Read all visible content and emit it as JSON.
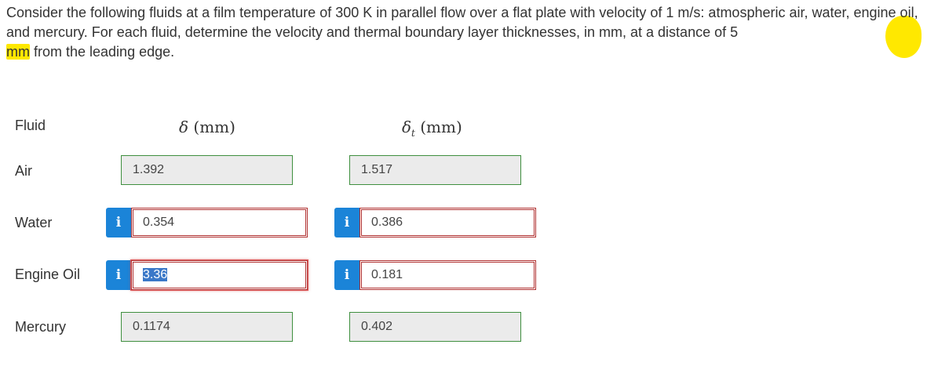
{
  "question": {
    "part1": "Consider the following fluids at a film temperature of 300 K in parallel flow over a flat plate with velocity of 1 m/s: atmospheric air, water, engine oil, and mercury. For each fluid, determine the velocity and thermal boundary layer thicknesses, in mm, at a distance ",
    "highlight1": "of 5",
    "highlight2": "mm",
    "part2": " from the leading edge."
  },
  "table": {
    "headers": {
      "fluid": "Fluid",
      "delta_symbol": "δ",
      "delta_unit": " (mm)",
      "delta_t_symbol": "δ",
      "delta_t_sub": "t",
      "delta_t_unit": " (mm)"
    },
    "rows": [
      {
        "label": "Air",
        "delta": "1.392",
        "delta_t": "1.517"
      },
      {
        "label": "Water",
        "delta": "0.354",
        "delta_t": "0.386"
      },
      {
        "label": "Engine Oil",
        "delta": "3.36",
        "delta_t": "0.181"
      },
      {
        "label": "Mercury",
        "delta": "0.1174",
        "delta_t": "0.402"
      }
    ],
    "info_icon": "i"
  },
  "colors": {
    "highlight": "#ffe800",
    "info_button": "#1b84d8",
    "correct_border": "#3f8f3f",
    "wrong_border": "#b03030",
    "selection": "#3a78c8"
  },
  "icons": {
    "info": "info-icon"
  }
}
